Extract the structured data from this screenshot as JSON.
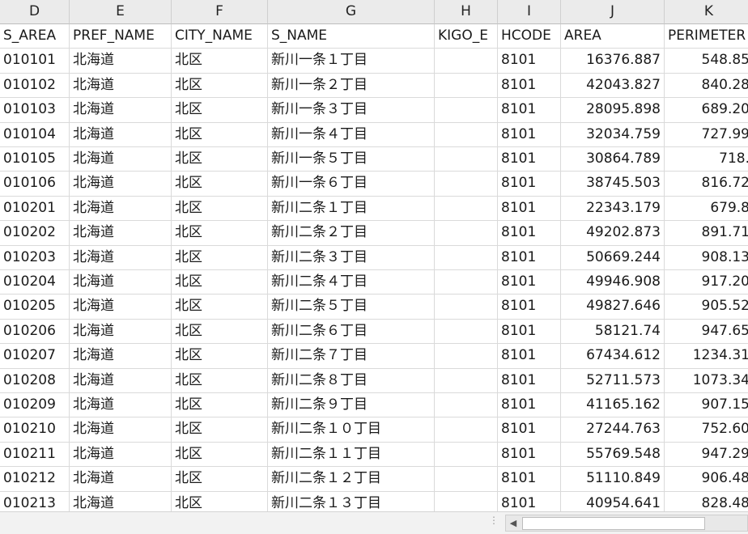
{
  "columns": [
    {
      "letter": "D",
      "header": "S_AREA",
      "align": "left"
    },
    {
      "letter": "E",
      "header": "PREF_NAME",
      "align": "left"
    },
    {
      "letter": "F",
      "header": "CITY_NAME",
      "align": "left"
    },
    {
      "letter": "G",
      "header": "S_NAME",
      "align": "left"
    },
    {
      "letter": "H",
      "header": "KIGO_E",
      "align": "left"
    },
    {
      "letter": "I",
      "header": "HCODE",
      "align": "left"
    },
    {
      "letter": "J",
      "header": "AREA",
      "align": "right"
    },
    {
      "letter": "K",
      "header": "PERIMETER",
      "align": "right"
    }
  ],
  "rows": [
    [
      "010101",
      "北海道",
      "北区",
      "新川一条１丁目",
      "",
      "8101",
      "16376.887",
      "548.85"
    ],
    [
      "010102",
      "北海道",
      "北区",
      "新川一条２丁目",
      "",
      "8101",
      "42043.827",
      "840.28"
    ],
    [
      "010103",
      "北海道",
      "北区",
      "新川一条３丁目",
      "",
      "8101",
      "28095.898",
      "689.20"
    ],
    [
      "010104",
      "北海道",
      "北区",
      "新川一条４丁目",
      "",
      "8101",
      "32034.759",
      "727.99"
    ],
    [
      "010105",
      "北海道",
      "北区",
      "新川一条５丁目",
      "",
      "8101",
      "30864.789",
      "718."
    ],
    [
      "010106",
      "北海道",
      "北区",
      "新川一条６丁目",
      "",
      "8101",
      "38745.503",
      "816.72"
    ],
    [
      "010201",
      "北海道",
      "北区",
      "新川二条１丁目",
      "",
      "8101",
      "22343.179",
      "679.8"
    ],
    [
      "010202",
      "北海道",
      "北区",
      "新川二条２丁目",
      "",
      "8101",
      "49202.873",
      "891.71"
    ],
    [
      "010203",
      "北海道",
      "北区",
      "新川二条３丁目",
      "",
      "8101",
      "50669.244",
      "908.13"
    ],
    [
      "010204",
      "北海道",
      "北区",
      "新川二条４丁目",
      "",
      "8101",
      "49946.908",
      "917.20"
    ],
    [
      "010205",
      "北海道",
      "北区",
      "新川二条５丁目",
      "",
      "8101",
      "49827.646",
      "905.52"
    ],
    [
      "010206",
      "北海道",
      "北区",
      "新川二条６丁目",
      "",
      "8101",
      "58121.74",
      "947.65"
    ],
    [
      "010207",
      "北海道",
      "北区",
      "新川二条７丁目",
      "",
      "8101",
      "67434.612",
      "1234.31"
    ],
    [
      "010208",
      "北海道",
      "北区",
      "新川二条８丁目",
      "",
      "8101",
      "52711.573",
      "1073.34"
    ],
    [
      "010209",
      "北海道",
      "北区",
      "新川二条９丁目",
      "",
      "8101",
      "41165.162",
      "907.15"
    ],
    [
      "010210",
      "北海道",
      "北区",
      "新川二条１０丁目",
      "",
      "8101",
      "27244.763",
      "752.60"
    ],
    [
      "010211",
      "北海道",
      "北区",
      "新川二条１１丁目",
      "",
      "8101",
      "55769.548",
      "947.29"
    ],
    [
      "010212",
      "北海道",
      "北区",
      "新川二条１２丁目",
      "",
      "8101",
      "51110.849",
      "906.48"
    ],
    [
      "010213",
      "北海道",
      "北区",
      "新川二条１３丁目",
      "",
      "8101",
      "40954.641",
      "828.48"
    ]
  ],
  "statusbar": {
    "scroll_left_icon": "chevron-left-icon",
    "grip_icon": "grip-icon"
  }
}
